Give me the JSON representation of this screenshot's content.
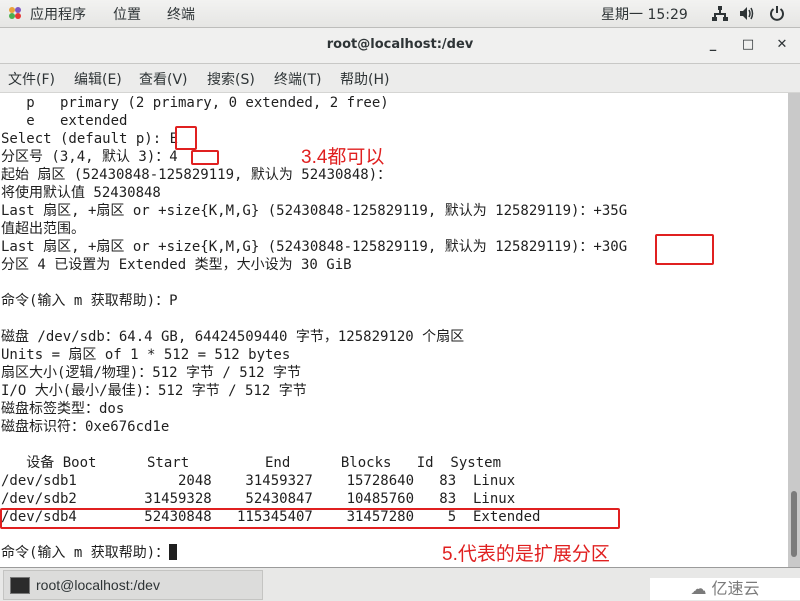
{
  "topbar": {
    "applications": "应用程序",
    "places": "位置",
    "terminal": "终端",
    "clock": "星期一 15:29",
    "icons": [
      "network-icon",
      "volume-icon",
      "power-icon"
    ]
  },
  "window": {
    "title": "root@localhost:/dev",
    "minimize": "_",
    "maximize": "□",
    "close": "✕"
  },
  "menubar": {
    "items": [
      "文件(F)",
      "编辑(E)",
      "查看(V)",
      "搜索(S)",
      "终端(T)",
      "帮助(H)"
    ]
  },
  "terminal": {
    "lines": [
      "   p   primary (2 primary, 0 extended, 2 free)",
      "   e   extended",
      "Select (default p): E",
      "分区号 (3,4, 默认 3)：4",
      "起始 扇区 (52430848-125829119, 默认为 52430848)：",
      "将使用默认值 52430848",
      "Last 扇区, +扇区 or +size{K,M,G} (52430848-125829119, 默认为 125829119)：+35G",
      "值超出范围。",
      "Last 扇区, +扇区 or +size{K,M,G} (52430848-125829119, 默认为 125829119)：+30G",
      "分区 4 已设置为 Extended 类型，大小设为 30 GiB",
      "",
      "命令(输入 m 获取帮助)：P",
      "",
      "磁盘 /dev/sdb：64.4 GB, 64424509440 字节，125829120 个扇区",
      "Units = 扇区 of 1 * 512 = 512 bytes",
      "扇区大小(逻辑/物理)：512 字节 / 512 字节",
      "I/O 大小(最小/最佳)：512 字节 / 512 字节",
      "磁盘标签类型：dos",
      "磁盘标识符：0xe676cd1e",
      ""
    ],
    "table": {
      "header": "   设备 Boot      Start         End      Blocks   Id  System",
      "rows": [
        "/dev/sdb1            2048    31459327    15728640   83  Linux",
        "/dev/sdb2        31459328    52430847    10485760   83  Linux",
        "/dev/sdb4        52430848   115345407    31457280    5  Extended"
      ]
    },
    "prompt": "命令(输入 m 获取帮助)："
  },
  "annotations": {
    "note_partition": "3.4都可以",
    "note_extended": "5.代表的是扩展分区",
    "color": "#e02020"
  },
  "taskbar": {
    "task_label": "root@localhost:/dev"
  },
  "watermark": "亿速云"
}
